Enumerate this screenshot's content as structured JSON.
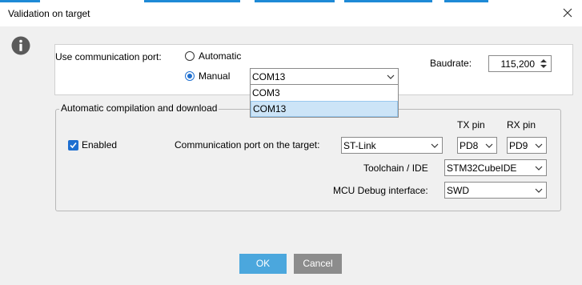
{
  "window": {
    "title": "Validation on target",
    "accent_color": "#1e8ad6"
  },
  "icons": {
    "info": "info-icon",
    "close": "close-icon",
    "dropdown": "chevron-down-icon",
    "spin": "spin-updown-icon",
    "check": "checkmark-icon"
  },
  "port": {
    "label": "Use communication port:",
    "automatic_label": "Automatic",
    "automatic_selected": false,
    "manual_label": "Manual",
    "manual_selected": true,
    "selected_port": "COM13",
    "dropdown_open": true,
    "options": [
      "COM3",
      "COM13"
    ],
    "highlighted_option": "COM13",
    "baudrate_label": "Baudrate:",
    "baudrate_value": "115,200"
  },
  "compile": {
    "legend": "Automatic compilation and download",
    "enabled_label": "Enabled",
    "enabled_checked": true,
    "comm_port_label": "Communication port on the target:",
    "comm_port_value": "ST-Link",
    "tx_label": "TX pin",
    "tx_value": "PD8",
    "rx_label": "RX pin",
    "rx_value": "PD9",
    "toolchain_label": "Toolchain / IDE",
    "toolchain_value": "STM32CubeIDE",
    "debug_label": "MCU Debug interface:",
    "debug_value": "SWD"
  },
  "buttons": {
    "ok_label": "OK",
    "cancel_label": "Cancel"
  }
}
